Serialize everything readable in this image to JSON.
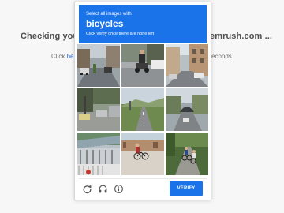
{
  "background": {
    "heading_left": "Checking you",
    "heading_right": "emrush.com ...",
    "sub_left_prefix": "Click ",
    "sub_left_link": "he",
    "sub_right": "econds."
  },
  "challenge": {
    "instruction": "Select all images with",
    "target_word": "bicycles",
    "hint": "Click verify once there are none left",
    "tiles": [
      {
        "label": "street-scene"
      },
      {
        "label": "street-scene"
      },
      {
        "label": "street-scene"
      },
      {
        "label": "street-scene"
      },
      {
        "label": "road-scene"
      },
      {
        "label": "road-scene"
      },
      {
        "label": "bicycle-parking-scene"
      },
      {
        "label": "cyclist-scene"
      },
      {
        "label": "cyclist-scene"
      }
    ],
    "verify_label": "VERIFY",
    "icons": {
      "reload": "reload-icon",
      "audio": "headphones-icon",
      "info": "info-icon"
    }
  },
  "colors": {
    "accent": "#1a73e8",
    "header_text": "#ffffff"
  }
}
